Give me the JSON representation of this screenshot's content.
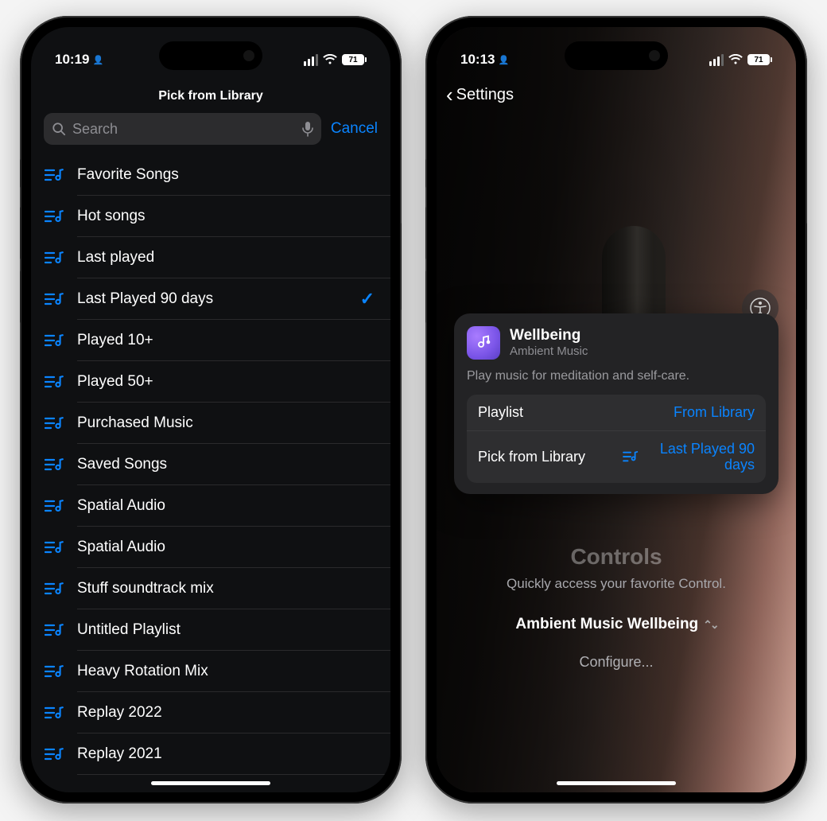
{
  "left": {
    "status": {
      "time": "10:19",
      "battery": "71"
    },
    "nav_title": "Pick from Library",
    "search": {
      "placeholder": "Search",
      "cancel": "Cancel"
    },
    "playlists": [
      {
        "label": "Favorite Songs",
        "selected": false
      },
      {
        "label": "Hot songs",
        "selected": false
      },
      {
        "label": "Last played",
        "selected": false
      },
      {
        "label": "Last Played 90 days",
        "selected": true
      },
      {
        "label": "Played 10+",
        "selected": false
      },
      {
        "label": "Played 50+",
        "selected": false
      },
      {
        "label": "Purchased Music",
        "selected": false
      },
      {
        "label": "Saved Songs",
        "selected": false
      },
      {
        "label": "Spatial Audio",
        "selected": false
      },
      {
        "label": "Spatial Audio",
        "selected": false
      },
      {
        "label": "Stuff soundtrack mix",
        "selected": false
      },
      {
        "label": "Untitled Playlist",
        "selected": false
      },
      {
        "label": "Heavy Rotation Mix",
        "selected": false
      },
      {
        "label": "Replay 2022",
        "selected": false
      },
      {
        "label": "Replay 2021",
        "selected": false
      }
    ]
  },
  "right": {
    "status": {
      "time": "10:13",
      "battery": "71"
    },
    "back_label": "Settings",
    "popup": {
      "title": "Wellbeing",
      "subtitle": "Ambient Music",
      "description": "Play music for meditation and self-care.",
      "rows": {
        "playlist": {
          "label": "Playlist",
          "value": "From Library"
        },
        "pick": {
          "label": "Pick from Library",
          "value": "Last Played 90 days"
        }
      }
    },
    "controls": {
      "heading": "Controls",
      "subtitle": "Quickly access your favorite Control.",
      "selector": "Ambient Music Wellbeing",
      "configure": "Configure..."
    }
  }
}
